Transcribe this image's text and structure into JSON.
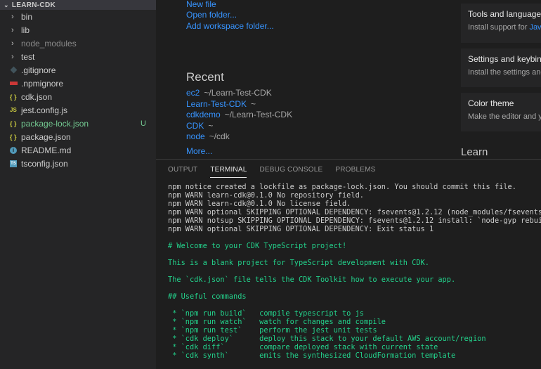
{
  "explorer": {
    "root_label": "LEARN-CDK",
    "items": [
      {
        "label": "bin",
        "kind": "folder"
      },
      {
        "label": "lib",
        "kind": "folder"
      },
      {
        "label": "node_modules",
        "kind": "folder"
      },
      {
        "label": "test",
        "kind": "folder"
      },
      {
        "label": ".gitignore",
        "kind": "file",
        "icon": "git-icon"
      },
      {
        "label": ".npmignore",
        "kind": "file",
        "icon": "npm-icon"
      },
      {
        "label": "cdk.json",
        "kind": "file",
        "icon": "json-icon"
      },
      {
        "label": "jest.config.js",
        "kind": "file",
        "icon": "js-icon"
      },
      {
        "label": "package-lock.json",
        "kind": "file",
        "icon": "json-icon",
        "badge": "U"
      },
      {
        "label": "package.json",
        "kind": "file",
        "icon": "json-icon"
      },
      {
        "label": "README.md",
        "kind": "file",
        "icon": "info-icon"
      },
      {
        "label": "tsconfig.json",
        "kind": "file",
        "icon": "ts-icon"
      }
    ]
  },
  "welcome": {
    "start_links": [
      "New file",
      "Open folder...",
      "Add workspace folder..."
    ],
    "recent_title": "Recent",
    "recent": [
      {
        "name": "ec2",
        "path": "~/Learn-Test-CDK"
      },
      {
        "name": "Learn-Test-CDK",
        "path": "~"
      },
      {
        "name": "cdkdemo",
        "path": "~/Learn-Test-CDK"
      },
      {
        "name": "CDK",
        "path": "~"
      },
      {
        "name": "node",
        "path": "~/cdk"
      }
    ],
    "more_label": "More...",
    "cards": [
      {
        "title": "Tools and languages",
        "desc": "Install support for ",
        "desc_link": "Java"
      },
      {
        "title": "Settings and keybindings",
        "desc": "Install the settings and keyboard"
      },
      {
        "title": "Color theme",
        "desc": "Make the editor and your code look"
      }
    ],
    "learn_title": "Learn"
  },
  "panel": {
    "tabs": [
      "OUTPUT",
      "TERMINAL",
      "DEBUG CONSOLE",
      "PROBLEMS"
    ],
    "active_tab": "TERMINAL",
    "terminal_lines": [
      {
        "text": "npm notice created a lockfile as package-lock.json. You should commit this file.",
        "style": "normal"
      },
      {
        "text": "npm WARN learn-cdk@0.1.0 No repository field.",
        "style": "normal"
      },
      {
        "text": "npm WARN learn-cdk@0.1.0 No license field.",
        "style": "normal"
      },
      {
        "text": "npm WARN optional SKIPPING OPTIONAL DEPENDENCY: fsevents@1.2.12 (node_modules/fsevents):",
        "style": "normal"
      },
      {
        "text": "npm WARN notsup SKIPPING OPTIONAL DEPENDENCY: fsevents@1.2.12 install: `node-gyp rebuild`",
        "style": "normal"
      },
      {
        "text": "npm WARN optional SKIPPING OPTIONAL DEPENDENCY: Exit status 1",
        "style": "normal"
      },
      {
        "text": "",
        "style": "blank"
      },
      {
        "text": "# Welcome to your CDK TypeScript project!",
        "style": "green"
      },
      {
        "text": "",
        "style": "blank"
      },
      {
        "text": "This is a blank project for TypeScript development with CDK.",
        "style": "green"
      },
      {
        "text": "",
        "style": "blank"
      },
      {
        "text": "The `cdk.json` file tells the CDK Toolkit how to execute your app.",
        "style": "green"
      },
      {
        "text": "",
        "style": "blank"
      },
      {
        "text": "## Useful commands",
        "style": "green"
      },
      {
        "text": "",
        "style": "blank"
      },
      {
        "text": " * `npm run build`   compile typescript to js",
        "style": "green"
      },
      {
        "text": " * `npm run watch`   watch for changes and compile",
        "style": "green"
      },
      {
        "text": " * `npm run test`    perform the jest unit tests",
        "style": "green"
      },
      {
        "text": " * `cdk deploy`      deploy this stack to your default AWS account/region",
        "style": "green"
      },
      {
        "text": " * `cdk diff`        compare deployed stack with current state",
        "style": "green"
      },
      {
        "text": " * `cdk synth`       emits the synthesized CloudFormation template",
        "style": "green"
      }
    ]
  }
}
